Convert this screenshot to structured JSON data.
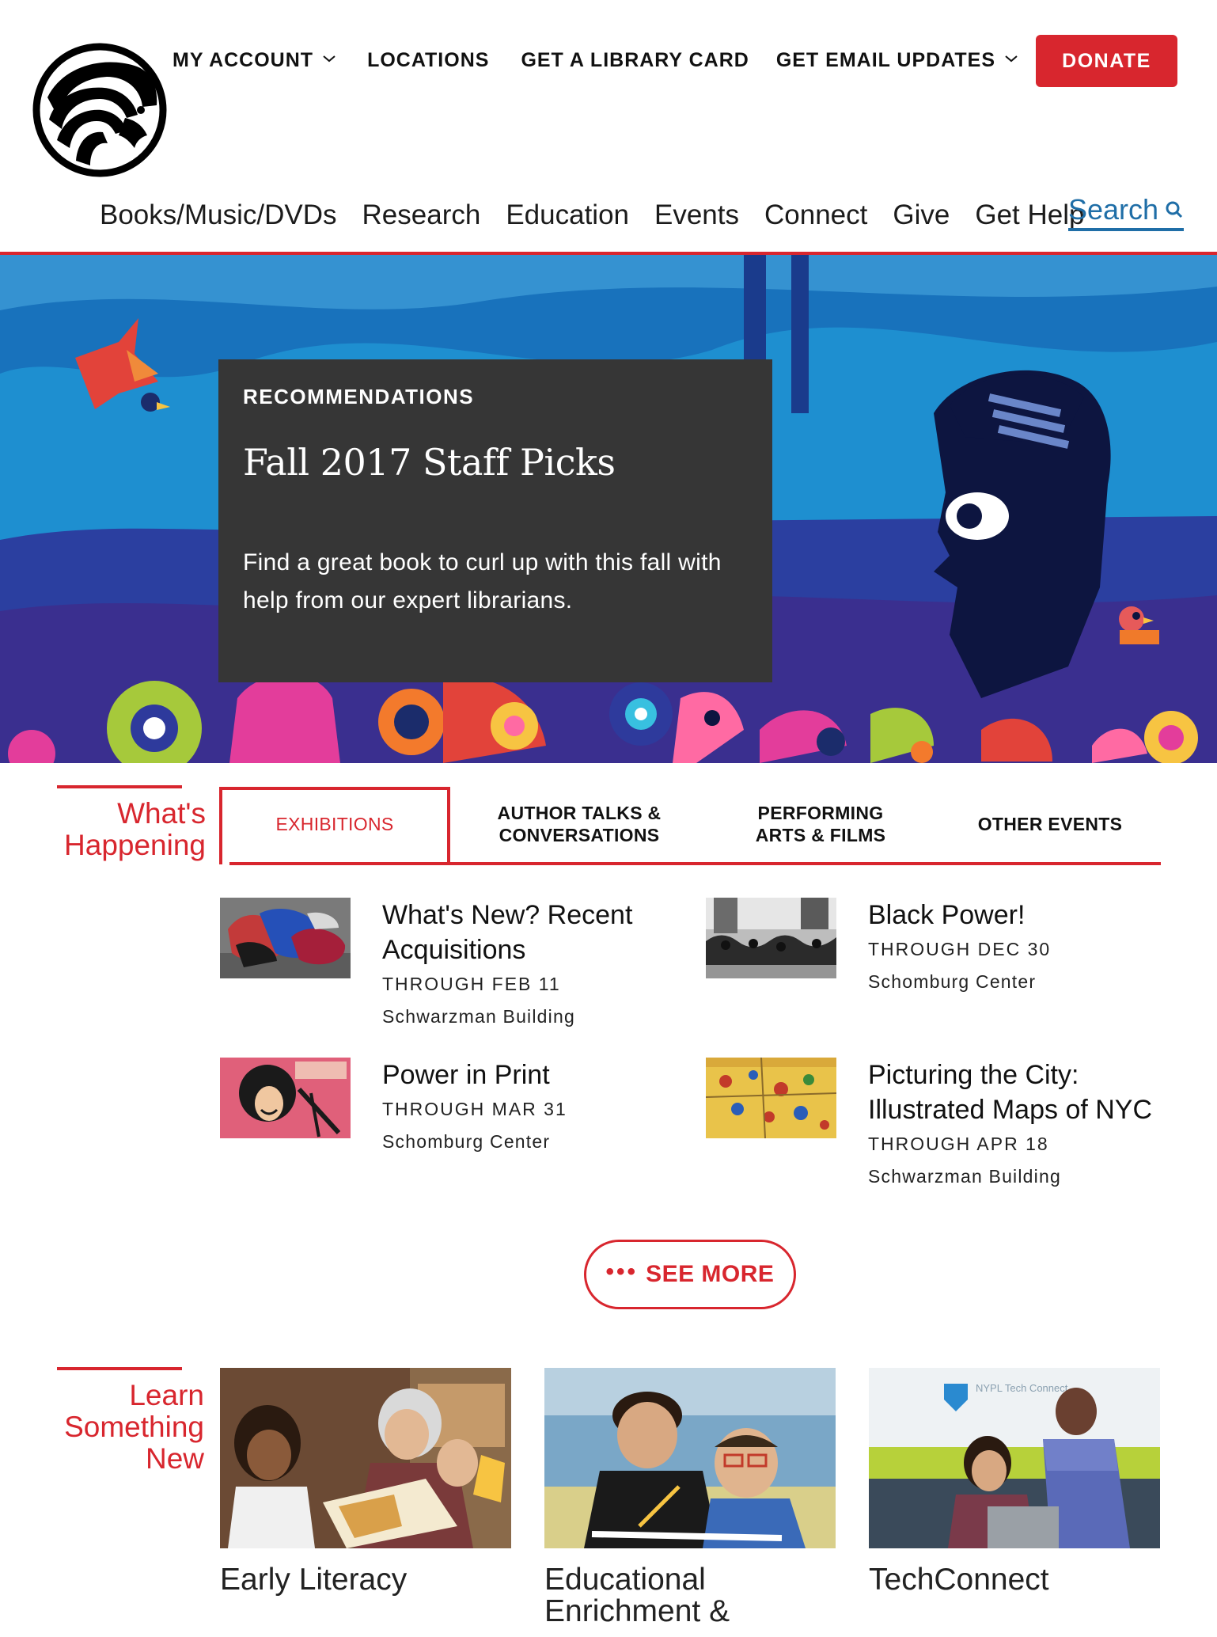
{
  "header": {
    "utility_nav": [
      {
        "label": "MY ACCOUNT",
        "has_dropdown": true
      },
      {
        "label": "LOCATIONS",
        "has_dropdown": false
      },
      {
        "label": "GET A LIBRARY CARD",
        "has_dropdown": false
      },
      {
        "label": "GET EMAIL UPDATES",
        "has_dropdown": true
      }
    ],
    "donate_label": "DONATE",
    "main_nav": [
      "Books/Music/DVDs",
      "Research",
      "Education",
      "Events",
      "Connect",
      "Give",
      "Get Help"
    ],
    "search_label": "Search"
  },
  "hero": {
    "eyebrow": "RECOMMENDATIONS",
    "title": "Fall 2017 Staff Picks",
    "description": "Find a great book to curl up with this fall with help from our expert librarians."
  },
  "whats_happening": {
    "title_line1": "What's",
    "title_line2": "Happening",
    "tabs": [
      {
        "line1": "EXHIBITIONS",
        "line2": "",
        "active": true
      },
      {
        "line1": "AUTHOR TALKS &",
        "line2": "CONVERSATIONS",
        "active": false
      },
      {
        "line1": "PERFORMING",
        "line2": "ARTS & FILMS",
        "active": false
      },
      {
        "line1": "OTHER EVENTS",
        "line2": "",
        "active": false
      }
    ],
    "events": [
      {
        "title_line1": "What's New? Recent",
        "title_line2": "Acquisitions",
        "date": "THROUGH FEB 11",
        "location": "Schwarzman Building"
      },
      {
        "title_line1": "Black Power!",
        "title_line2": "",
        "date": "THROUGH DEC 30",
        "location": "Schomburg Center"
      },
      {
        "title_line1": "Power in Print",
        "title_line2": "",
        "date": "THROUGH MAR 31",
        "location": "Schomburg Center"
      },
      {
        "title_line1": "Picturing the City:",
        "title_line2": "Illustrated Maps of NYC",
        "date": "THROUGH APR 18",
        "location": "Schwarzman Building"
      }
    ],
    "see_more_label": "SEE MORE"
  },
  "learn": {
    "title_line1": "Learn",
    "title_line2": "Something",
    "title_line3": "New",
    "cards": [
      {
        "caption_line1": "Early Literacy",
        "caption_line2": ""
      },
      {
        "caption_line1": "Educational",
        "caption_line2": "Enrichment &"
      },
      {
        "caption_line1": "TechConnect",
        "caption_line2": ""
      }
    ],
    "photo_sign_text": "NYPL Tech Connect"
  },
  "colors": {
    "brand_red": "#d8262e",
    "search_blue": "#1f6ea7",
    "hero_card_bg": "#363636"
  },
  "icons": [
    "nypl-lion-logo",
    "chevron-down-icon",
    "search-icon",
    "ellipsis-icon"
  ]
}
